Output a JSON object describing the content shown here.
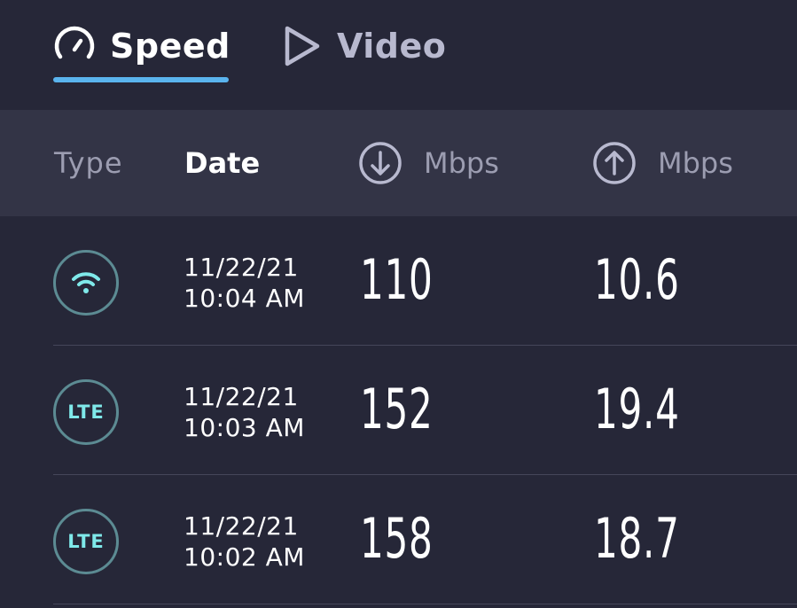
{
  "tabs": [
    {
      "label": "Speed",
      "icon": "speedometer-icon",
      "active": true
    },
    {
      "label": "Video",
      "icon": "play-icon",
      "active": false
    }
  ],
  "columns": {
    "type": "Type",
    "date": "Date",
    "download_unit": "Mbps",
    "upload_unit": "Mbps"
  },
  "rows": [
    {
      "type": "wifi",
      "type_label": "",
      "date": "11/22/21",
      "time": "10:04 AM",
      "download": "110",
      "upload": "10.6"
    },
    {
      "type": "lte",
      "type_label": "LTE",
      "date": "11/22/21",
      "time": "10:03 AM",
      "download": "152",
      "upload": "19.4"
    },
    {
      "type": "lte",
      "type_label": "LTE",
      "date": "11/22/21",
      "time": "10:02 AM",
      "download": "158",
      "upload": "18.7"
    }
  ],
  "colors": {
    "background": "#262738",
    "header_band": "#333446",
    "accent": "#5ab4ee",
    "badge_text": "#7fe9ea",
    "badge_ring": "#5c8b93"
  }
}
